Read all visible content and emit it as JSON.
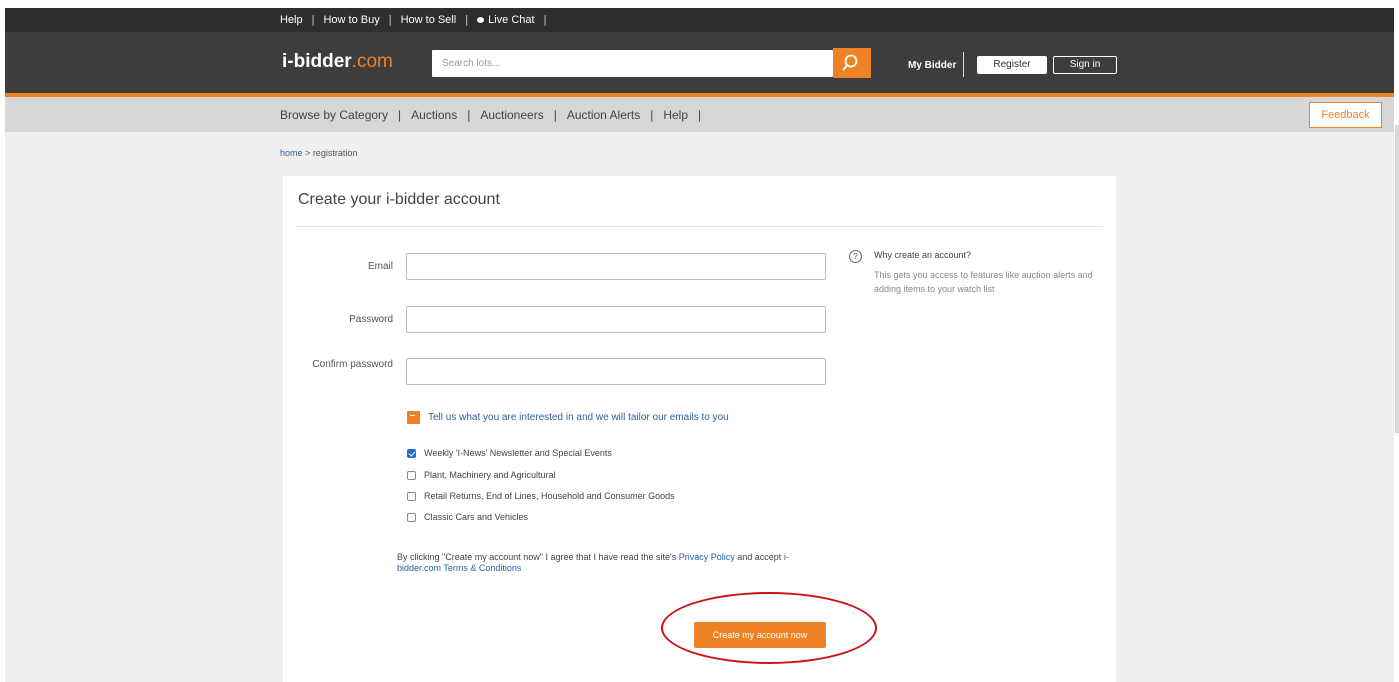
{
  "top_links": {
    "help": "Help",
    "how_to_buy": "How to Buy",
    "how_to_sell": "How to Sell",
    "live_chat": "Live Chat",
    "separator": "|"
  },
  "header": {
    "logo_main": "i-bidder",
    "logo_suffix": ".com",
    "search_placeholder": "Search lots...",
    "my_bidder": "My Bidder",
    "register": "Register",
    "sign_in": "Sign in"
  },
  "nav": {
    "items": [
      "Browse by Category",
      "Auctions",
      "Auctioneers",
      "Auction Alerts",
      "Help"
    ],
    "separator": "|",
    "feedback": "Feedback"
  },
  "breadcrumb": {
    "home": "home",
    "arrow": ">",
    "current": "registration"
  },
  "form": {
    "title": "Create your i-bidder account",
    "email_label": "Email",
    "email_value": "",
    "password_label": "Password",
    "password_value": "",
    "confirm_label": "Confirm password",
    "confirm_value": "",
    "why_icon": "?",
    "why_title": "Why create an account?",
    "why_text": "This gets you access to features like auction alerts and adding items to your watch list",
    "tailor_text": "Tell us what you are interested in and we will tailor our emails to you",
    "options": [
      {
        "label": "Weekly 'I-News' Newsletter and Special Events",
        "checked": true
      },
      {
        "label": "Plant, Machinery and Agricultural",
        "checked": false
      },
      {
        "label": "Retail Returns, End of Lines, Household and Consumer Goods",
        "checked": false
      },
      {
        "label": "Classic Cars and Vehicles",
        "checked": false
      }
    ],
    "terms_prefix": "By clicking \"Create my account now\" I agree that I have read the site's ",
    "privacy_link": "Privacy Policy",
    "terms_mid": " and accept ",
    "terms_link": "i-bidder.com Terms & Conditions",
    "submit": "Create my account now"
  },
  "colors": {
    "accent": "#f08226",
    "header_bg": "#3d3d3d",
    "link": "#2f5f9e",
    "highlight": "#c91414"
  }
}
